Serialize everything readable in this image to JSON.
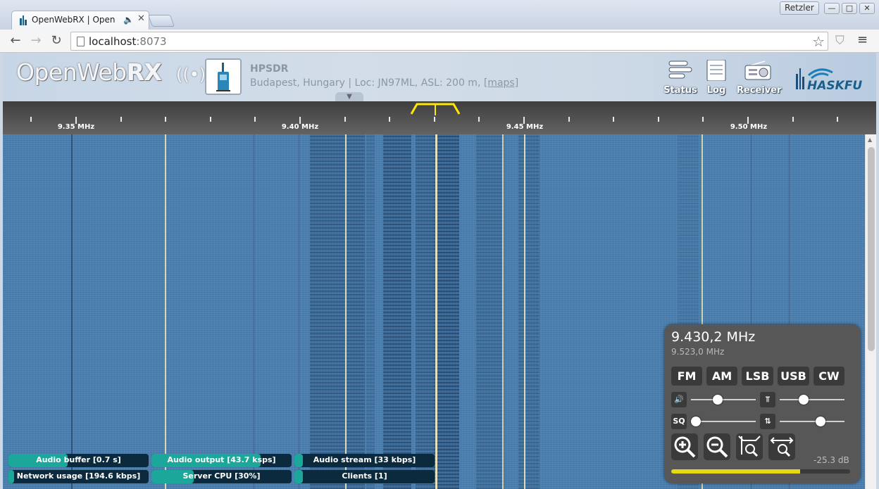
{
  "browser": {
    "tab_title": "OpenWebRX | OpenWebRX",
    "profile_name": "Retzler",
    "url_host": "localhost",
    "url_port": ":8073",
    "window_buttons": {
      "minimize": "—",
      "maximize": "□",
      "close": "✕"
    }
  },
  "header": {
    "logo_light": "OpenWeb",
    "logo_bold": "RX",
    "receiver_name": "HPSDR",
    "receiver_location": "Budapest, Hungary | Loc: JN97ML, ASL: 200 m, ",
    "maps_link": "[maps]",
    "buttons": [
      {
        "label": "Status",
        "icon": "status-icon"
      },
      {
        "label": "Log",
        "icon": "log-icon"
      },
      {
        "label": "Receiver",
        "icon": "receiver-icon"
      }
    ],
    "sponsor_logo": "HASKFU"
  },
  "scale": {
    "labels": [
      "9.35 MHz",
      "9.40 MHz",
      "9.45 MHz",
      "9.50 MHz"
    ],
    "passband_color": "#ffe800"
  },
  "status_bars": [
    {
      "label": "Audio buffer [0.7 s]",
      "fill": 0.42
    },
    {
      "label": "Audio output [43.7 ksps]",
      "fill": 0.78
    },
    {
      "label": "Audio stream [33 kbps]",
      "fill": 0.06
    },
    {
      "label": "Network usage [194.6 kbps]",
      "fill": 0.04
    },
    {
      "label": "Server CPU [30%]",
      "fill": 0.3
    },
    {
      "label": "Clients [1]",
      "fill": 0.06
    }
  ],
  "panel": {
    "frequency": "9.430,2 MHz",
    "center_frequency": "9.523,0 MHz",
    "modes": [
      "FM",
      "AM",
      "LSB",
      "USB",
      "CW"
    ],
    "squelch_label": "SQ",
    "db_readout": "-25.3 dB",
    "volume_level": 0.4,
    "squelch_level": 0.0,
    "waterfall_max_level": 0.35,
    "waterfall_min_level": 0.65,
    "smeter_level": 0.72,
    "smeter_color": "#e8d80f"
  },
  "colors": {
    "waterfall_bg": "#4b80b0",
    "status_fill": "#1ca79b",
    "status_bg": "#0c2a3d",
    "panel_bg": "#575757"
  }
}
